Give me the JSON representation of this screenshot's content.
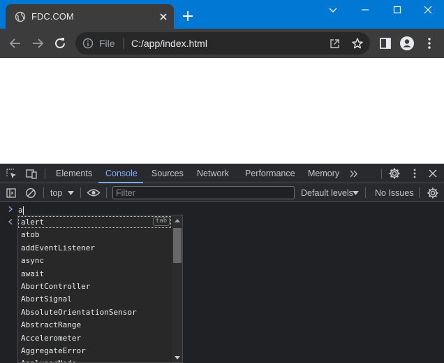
{
  "browser": {
    "tab_title": "FDC.COM",
    "omnibox": {
      "scheme_label": "File",
      "url": "C:/app/index.html"
    }
  },
  "devtools": {
    "tabs": [
      {
        "label": "Elements"
      },
      {
        "label": "Console"
      },
      {
        "label": "Sources"
      },
      {
        "label": "Network"
      },
      {
        "label": "Performance"
      },
      {
        "label": "Memory"
      }
    ],
    "console_bar": {
      "context": "top",
      "filter_placeholder": "Filter",
      "levels": "Default levels",
      "issues": "No Issues"
    },
    "prompt_input": "a",
    "autocomplete": {
      "tab_hint": "tab",
      "items": [
        "alert",
        "atob",
        "addEventListener",
        "async",
        "await",
        "AbortController",
        "AbortSignal",
        "AbsoluteOrientationSensor",
        "AbstractRange",
        "Accelerometer",
        "AggregateError",
        "AnalyserNode"
      ]
    }
  },
  "colors": {
    "titlebar": "#0078d4",
    "toolbar": "#3c3c3c",
    "devtools_accent": "#7cacf8"
  }
}
